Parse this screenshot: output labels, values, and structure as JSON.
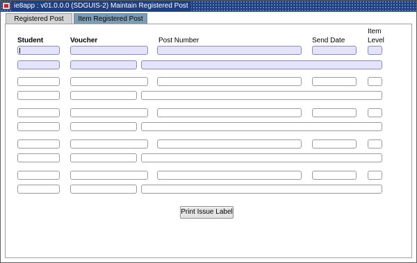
{
  "window": {
    "title": "ie8app : v01.0.0.0 (SDGUIS-2) Maintain Registered Post"
  },
  "tabs": [
    {
      "label": "Registered Post",
      "active": true
    },
    {
      "label": "Item Registered Post",
      "active": false
    }
  ],
  "columns": {
    "student": "Student",
    "voucher": "Voucher",
    "post_number": "Post Number",
    "send_date": "Send Date",
    "item_level_line1": "Item",
    "item_level_line2": "Level"
  },
  "records": [
    {
      "student": "",
      "voucher": "",
      "post_number": "",
      "send_date": "",
      "item_level": "",
      "voucher_sub": "",
      "remarks": ""
    },
    {
      "student": "",
      "voucher": "",
      "post_number": "",
      "send_date": "",
      "item_level": "",
      "voucher_sub": "",
      "remarks": ""
    },
    {
      "student": "",
      "voucher": "",
      "post_number": "",
      "send_date": "",
      "item_level": "",
      "voucher_sub": "",
      "remarks": ""
    },
    {
      "student": "",
      "voucher": "",
      "post_number": "",
      "send_date": "",
      "item_level": "",
      "voucher_sub": "",
      "remarks": ""
    },
    {
      "student": "",
      "voucher": "",
      "post_number": "",
      "send_date": "",
      "item_level": "",
      "voucher_sub": "",
      "remarks": ""
    }
  ],
  "actions": {
    "print_label": "Print Issue Label"
  },
  "colors": {
    "titlebar": "#1f3f7f",
    "active_tab": "#d4d4d4",
    "inactive_tab": "#7c9db4",
    "selected_field": "#e3e3fb"
  }
}
